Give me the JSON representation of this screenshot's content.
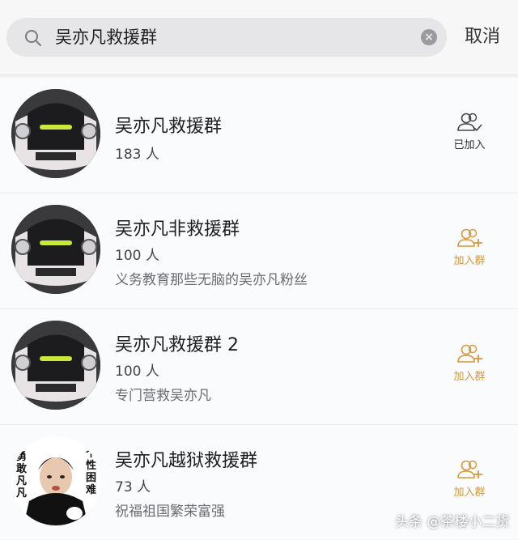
{
  "search": {
    "query": "吴亦凡救援群",
    "cancel_label": "取消"
  },
  "groups": [
    {
      "name": "吴亦凡救援群",
      "members": "183 人",
      "description": "",
      "action_label": "已加入",
      "action_icon": "group-joined-icon"
    },
    {
      "name": "吴亦凡非救援群",
      "members": "100 人",
      "description": "义务教育那些无脑的吴亦凡粉丝",
      "action_label": "加入群",
      "action_icon": "group-add-icon"
    },
    {
      "name": "吴亦凡救援群 2",
      "members": "100 人",
      "description": "专门营救吴亦凡",
      "action_label": "加入群",
      "action_icon": "group-add-icon"
    },
    {
      "name": "吴亦凡越狱救援群",
      "members": "73 人",
      "description": "祝福祖国繁荣富强",
      "action_label": "加入群",
      "action_icon": "group-add-icon"
    }
  ],
  "avatar4_text": {
    "left": "勇敢凡凡",
    "right": "个性困难"
  },
  "watermark": "头条 @茶楼小二货",
  "colors": {
    "join_accent": "#d9973a",
    "joined": "#333333",
    "background": "#f2f2f4"
  }
}
